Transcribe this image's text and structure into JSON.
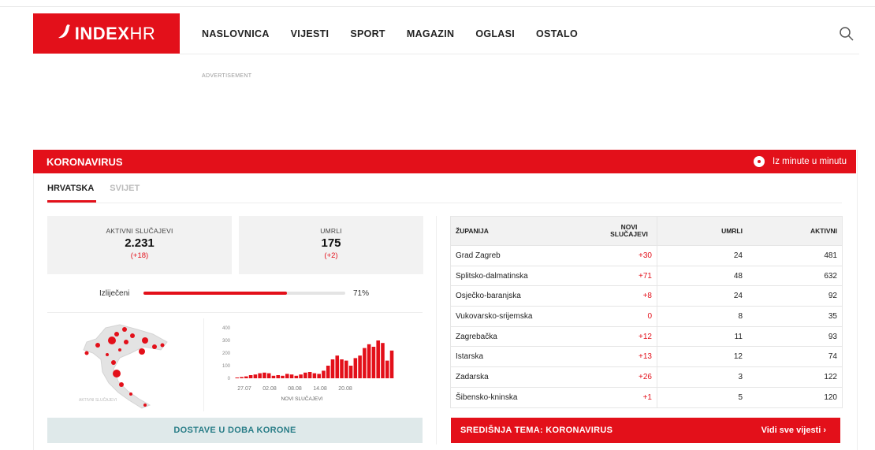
{
  "header": {
    "logo_text_bold": "INDEX",
    "logo_text_light": "HR",
    "nav": [
      "NASLOVNICA",
      "VIJESTI",
      "SPORT",
      "MAGAZIN",
      "OGLASI",
      "OSTALO"
    ],
    "advertisement": "ADVERTISEMENT"
  },
  "corona": {
    "title": "KORONAVIRUS",
    "live_label": "Iz minute u minutu",
    "tabs": [
      "HRVATSKA",
      "SVIJET"
    ],
    "active": {
      "label": "AKTIVNI SLUČAJEVI",
      "value": "2.231",
      "change": "(+18)"
    },
    "deaths": {
      "label": "UMRLI",
      "value": "175",
      "change": "(+2)"
    },
    "recovered": {
      "label": "Izliječeni",
      "percent_text": "71%",
      "fraction": 0.71
    },
    "map_caption": "AKTIVNI SLUČAJEVI",
    "dostave": "DOSTAVE U DOBA KORONE",
    "sredisnja": "SREDIŠNJA TEMA: KORONAVIRUS",
    "vidi_sve": "Vidi sve vijesti ›"
  },
  "table": {
    "headers": [
      "ŽUPANIJA",
      "NOVI SLUČAJEVI",
      "UMRLI",
      "AKTIVNI"
    ],
    "rows": [
      [
        "Grad Zagreb",
        "+30",
        "24",
        "481"
      ],
      [
        "Splitsko-dalmatinska",
        "+71",
        "48",
        "632"
      ],
      [
        "Osječko-baranjska",
        "+8",
        "24",
        "92"
      ],
      [
        "Vukovarsko-srijemska",
        "0",
        "8",
        "35"
      ],
      [
        "Zagrebačka",
        "+12",
        "11",
        "93"
      ],
      [
        "Istarska",
        "+13",
        "12",
        "74"
      ],
      [
        "Zadarska",
        "+26",
        "3",
        "122"
      ],
      [
        "Šibensko-kninska",
        "+1",
        "5",
        "120"
      ]
    ]
  },
  "colors": {
    "accent": "#e3101a",
    "teal": "#2a7e88",
    "panel_grey": "#f2f2f2"
  },
  "chart_data": {
    "type": "bar",
    "xlabel": "NOVI SLUČAJEVI",
    "ylim": [
      0,
      400
    ],
    "yticks": [
      0,
      100,
      200,
      300,
      400
    ],
    "xticks": [
      "27.07",
      "02.08",
      "08.08",
      "14.08",
      "20.08"
    ],
    "values": [
      5,
      10,
      15,
      25,
      30,
      40,
      45,
      40,
      20,
      25,
      20,
      35,
      30,
      20,
      30,
      45,
      50,
      40,
      35,
      60,
      100,
      150,
      180,
      150,
      140,
      100,
      160,
      180,
      240,
      270,
      250,
      300,
      280,
      140,
      220
    ]
  }
}
